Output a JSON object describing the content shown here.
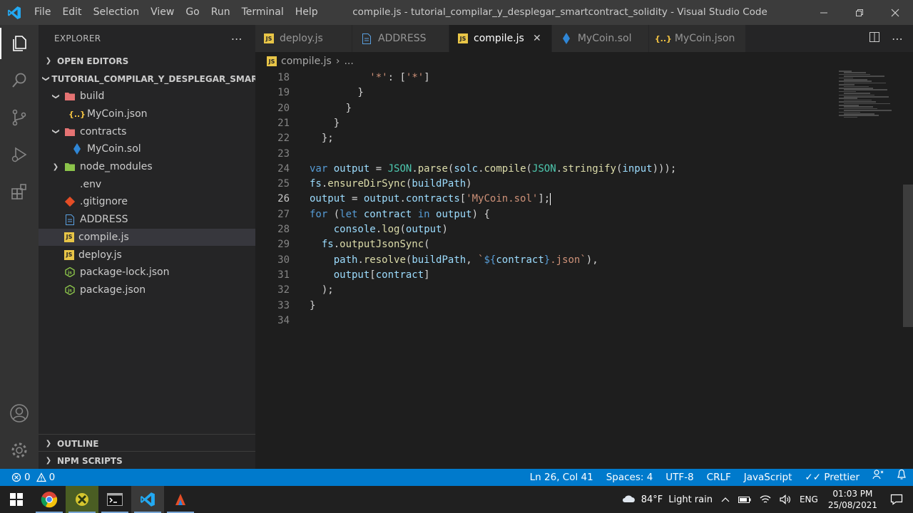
{
  "window": {
    "title": "compile.js - tutorial_compilar_y_desplegar_smartcontract_solidity - Visual Studio Code",
    "menu": [
      "File",
      "Edit",
      "Selection",
      "View",
      "Go",
      "Run",
      "Terminal",
      "Help"
    ]
  },
  "sidebar": {
    "title": "EXPLORER",
    "open_editors": "OPEN EDITORS",
    "project": "TUTORIAL_COMPILAR_Y_DESPLEGAR_SMARTC...",
    "tree": [
      {
        "label": "build",
        "type": "folder-open",
        "depth": 1
      },
      {
        "label": "MyCoin.json",
        "type": "json",
        "depth": 2
      },
      {
        "label": "contracts",
        "type": "folder-open",
        "depth": 1
      },
      {
        "label": "MyCoin.sol",
        "type": "sol",
        "depth": 2
      },
      {
        "label": "node_modules",
        "type": "folder",
        "depth": 1
      },
      {
        "label": ".env",
        "type": "env",
        "depth": 1
      },
      {
        "label": ".gitignore",
        "type": "git",
        "depth": 1
      },
      {
        "label": "ADDRESS",
        "type": "text",
        "depth": 1
      },
      {
        "label": "compile.js",
        "type": "js",
        "depth": 1
      },
      {
        "label": "deploy.js",
        "type": "js",
        "depth": 1
      },
      {
        "label": "package-lock.json",
        "type": "npm",
        "depth": 1
      },
      {
        "label": "package.json",
        "type": "npm",
        "depth": 1
      }
    ],
    "outline": "OUTLINE",
    "npm_scripts": "NPM SCRIPTS"
  },
  "tabs": [
    {
      "label": "deploy.js",
      "type": "js"
    },
    {
      "label": "ADDRESS",
      "type": "text"
    },
    {
      "label": "compile.js",
      "type": "js",
      "active": true
    },
    {
      "label": "MyCoin.sol",
      "type": "sol"
    },
    {
      "label": "MyCoin.json",
      "type": "json"
    }
  ],
  "breadcrumb": {
    "file": "compile.js",
    "rest": "..."
  },
  "editor": {
    "current_line": 26,
    "lines": [
      {
        "n": "18",
        "tokens": [
          [
            "p",
            "          "
          ],
          [
            "s",
            "'*'"
          ],
          [
            "p",
            ": ["
          ],
          [
            "s",
            "'*'"
          ],
          [
            "p",
            "]"
          ]
        ]
      },
      {
        "n": "19",
        "tokens": [
          [
            "p",
            "        }"
          ]
        ]
      },
      {
        "n": "20",
        "tokens": [
          [
            "p",
            "      }"
          ]
        ]
      },
      {
        "n": "21",
        "tokens": [
          [
            "p",
            "    }"
          ]
        ]
      },
      {
        "n": "22",
        "tokens": [
          [
            "p",
            "  };"
          ]
        ]
      },
      {
        "n": "23",
        "tokens": []
      },
      {
        "n": "24",
        "tokens": [
          [
            "k",
            "var "
          ],
          [
            "v",
            "output"
          ],
          [
            "p",
            " = "
          ],
          [
            "c",
            "JSON"
          ],
          [
            "p",
            "."
          ],
          [
            "f",
            "parse"
          ],
          [
            "p",
            "("
          ],
          [
            "v",
            "solc"
          ],
          [
            "p",
            "."
          ],
          [
            "f",
            "compile"
          ],
          [
            "p",
            "("
          ],
          [
            "c",
            "JSON"
          ],
          [
            "p",
            "."
          ],
          [
            "f",
            "stringify"
          ],
          [
            "p",
            "("
          ],
          [
            "v",
            "input"
          ],
          [
            "p",
            ")));"
          ]
        ]
      },
      {
        "n": "25",
        "tokens": [
          [
            "v",
            "fs"
          ],
          [
            "p",
            "."
          ],
          [
            "f",
            "ensureDirSync"
          ],
          [
            "p",
            "("
          ],
          [
            "v",
            "buildPath"
          ],
          [
            "p",
            ")"
          ]
        ]
      },
      {
        "n": "26",
        "tokens": [
          [
            "v",
            "output"
          ],
          [
            "p",
            " = "
          ],
          [
            "v",
            "output"
          ],
          [
            "p",
            "."
          ],
          [
            "v",
            "contracts"
          ],
          [
            "p",
            "["
          ],
          [
            "s",
            "'MyCoin.sol'"
          ],
          [
            "p",
            "];"
          ]
        ]
      },
      {
        "n": "27",
        "tokens": [
          [
            "k",
            "for"
          ],
          [
            "p",
            " ("
          ],
          [
            "k",
            "let "
          ],
          [
            "v",
            "contract"
          ],
          [
            "k",
            " in "
          ],
          [
            "v",
            "output"
          ],
          [
            "p",
            ") {"
          ]
        ]
      },
      {
        "n": "28",
        "tokens": [
          [
            "p",
            "    "
          ],
          [
            "v",
            "console"
          ],
          [
            "p",
            "."
          ],
          [
            "f",
            "log"
          ],
          [
            "p",
            "("
          ],
          [
            "v",
            "output"
          ],
          [
            "p",
            ")"
          ]
        ]
      },
      {
        "n": "29",
        "tokens": [
          [
            "p",
            "  "
          ],
          [
            "v",
            "fs"
          ],
          [
            "p",
            "."
          ],
          [
            "f",
            "outputJsonSync"
          ],
          [
            "p",
            "("
          ]
        ]
      },
      {
        "n": "30",
        "tokens": [
          [
            "p",
            "    "
          ],
          [
            "v",
            "path"
          ],
          [
            "p",
            "."
          ],
          [
            "f",
            "resolve"
          ],
          [
            "p",
            "("
          ],
          [
            "v",
            "buildPath"
          ],
          [
            "p",
            ", "
          ],
          [
            "s",
            "`"
          ],
          [
            "k",
            "${"
          ],
          [
            "v",
            "contract"
          ],
          [
            "k",
            "}"
          ],
          [
            "s",
            ".json`"
          ],
          [
            "p",
            "),"
          ]
        ]
      },
      {
        "n": "31",
        "tokens": [
          [
            "p",
            "    "
          ],
          [
            "v",
            "output"
          ],
          [
            "p",
            "["
          ],
          [
            "v",
            "contract"
          ],
          [
            "p",
            "]"
          ]
        ]
      },
      {
        "n": "32",
        "tokens": [
          [
            "p",
            "  );"
          ]
        ]
      },
      {
        "n": "33",
        "tokens": [
          [
            "p",
            "}"
          ]
        ]
      },
      {
        "n": "34",
        "tokens": []
      }
    ]
  },
  "status": {
    "errors": "0",
    "warnings": "0",
    "position": "Ln 26, Col 41",
    "spaces": "Spaces: 4",
    "encoding": "UTF-8",
    "eol": "CRLF",
    "language": "JavaScript",
    "prettier": "Prettier"
  },
  "taskbar": {
    "weather_temp": "84°F",
    "weather_desc": "Light rain",
    "lang": "ENG",
    "time": "01:03 PM",
    "date": "25/08/2021"
  },
  "colors": {
    "accent": "#007acc",
    "js": "#e8c547",
    "json": "#f5c542",
    "sol": "#2f86d6",
    "git": "#e44d26",
    "npm": "#8bc34a"
  }
}
